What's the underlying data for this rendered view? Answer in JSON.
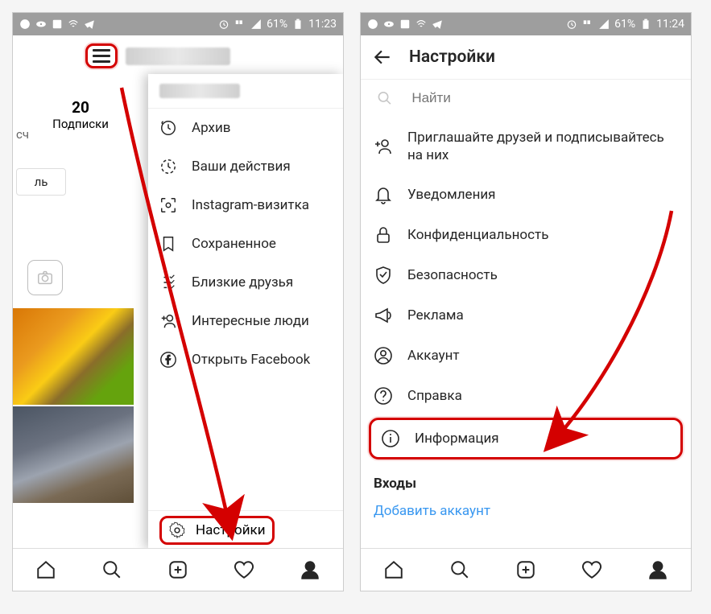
{
  "statusbar": {
    "battery_left": "61%",
    "time_left": "11:23",
    "battery_right": "61%",
    "time_right": "11:24"
  },
  "screen1": {
    "stat_count": "20",
    "stat_label": "Подписки",
    "stat_prefix": "сч",
    "edit_label": "ль",
    "menu": {
      "archive": "Архив",
      "activity": "Ваши действия",
      "nametag": "Instagram-визитка",
      "saved": "Сохраненное",
      "close_friends": "Близкие друзья",
      "discover": "Интересные люди",
      "facebook": "Открыть Facebook"
    },
    "settings_label": "Настройки"
  },
  "screen2": {
    "title": "Настройки",
    "search_placeholder": "Найти",
    "items": {
      "invite": "Приглашайте друзей и подписывайтесь на них",
      "notifications": "Уведомления",
      "privacy": "Конфиденциальность",
      "security": "Безопасность",
      "ads": "Реклама",
      "account": "Аккаунт",
      "help": "Справка",
      "about": "Информация"
    },
    "logins_label": "Входы",
    "add_account": "Добавить аккаунт"
  }
}
